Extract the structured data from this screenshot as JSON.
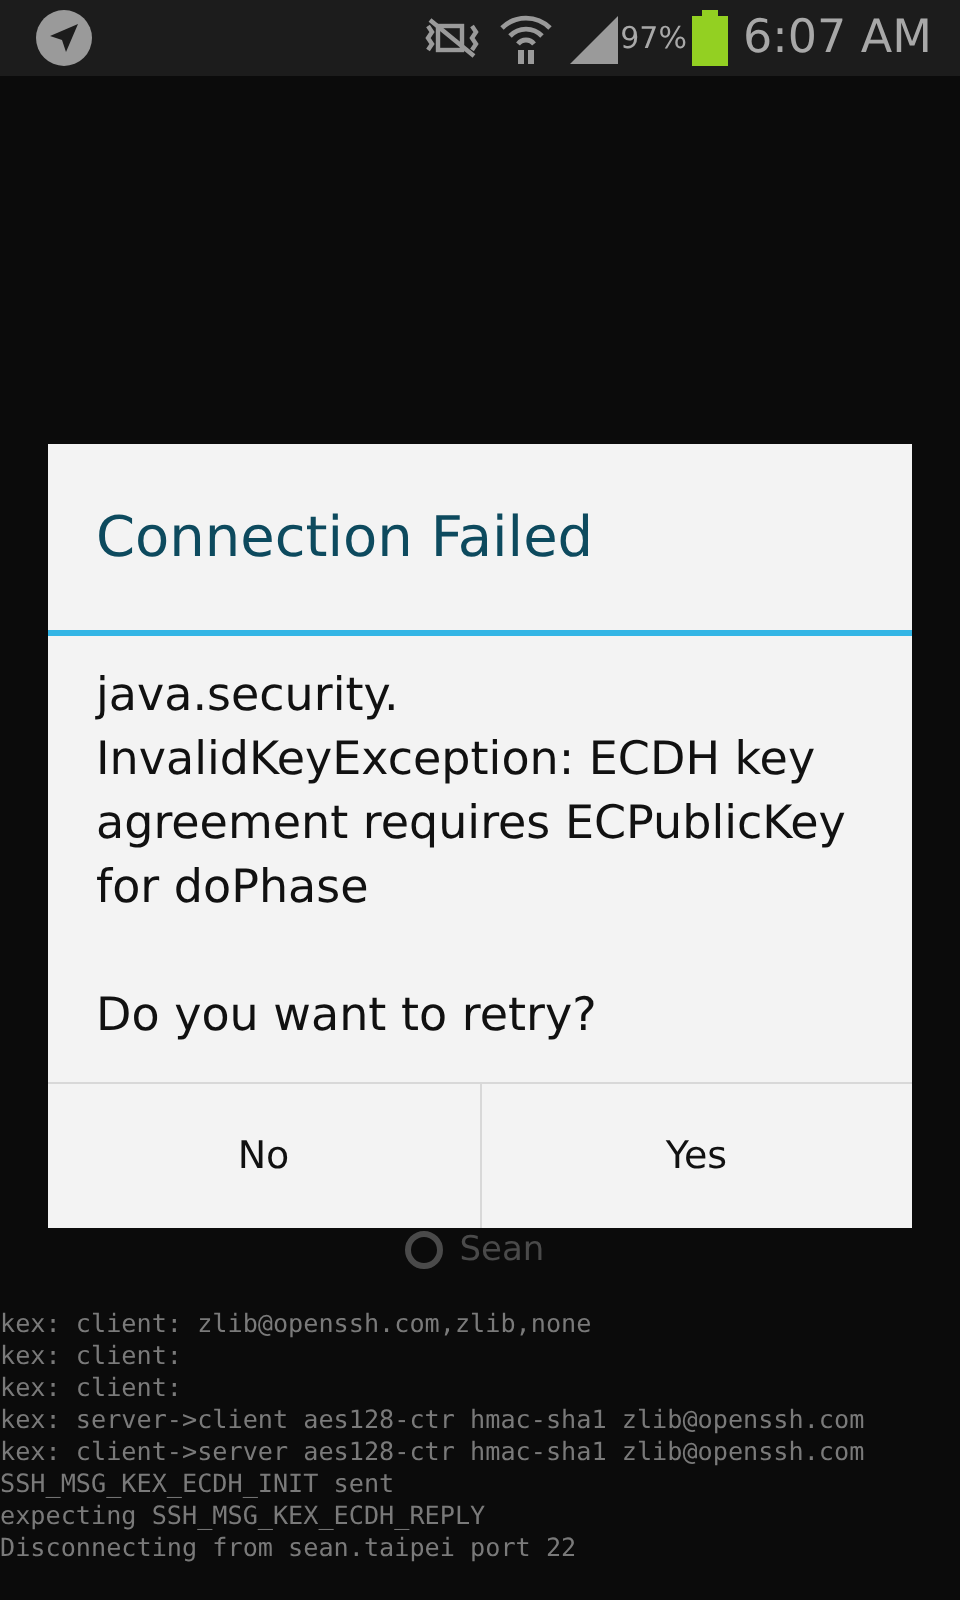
{
  "status_bar": {
    "battery_percent": "97%",
    "time": "6:07 AM"
  },
  "dialog": {
    "title": "Connection Failed",
    "message": "java.security.\nInvalidKeyException: ECDH key agreement requires ECPublicKey for doPhase\n\nDo you want to retry?",
    "buttons": [
      "No",
      "Yes"
    ]
  },
  "connection": {
    "host_label": "Sean"
  },
  "terminal": {
    "lines": [
      "kex: client: zlib@openssh.com,zlib,none",
      "kex: client:",
      "kex: client:",
      "kex: server->client aes128-ctr hmac-sha1 zlib@openssh.com",
      "kex: client->server aes128-ctr hmac-sha1 zlib@openssh.com",
      "SSH_MSG_KEX_ECDH_INIT sent",
      "expecting SSH_MSG_KEX_ECDH_REPLY",
      "Disconnecting from sean.taipei port 22"
    ]
  }
}
